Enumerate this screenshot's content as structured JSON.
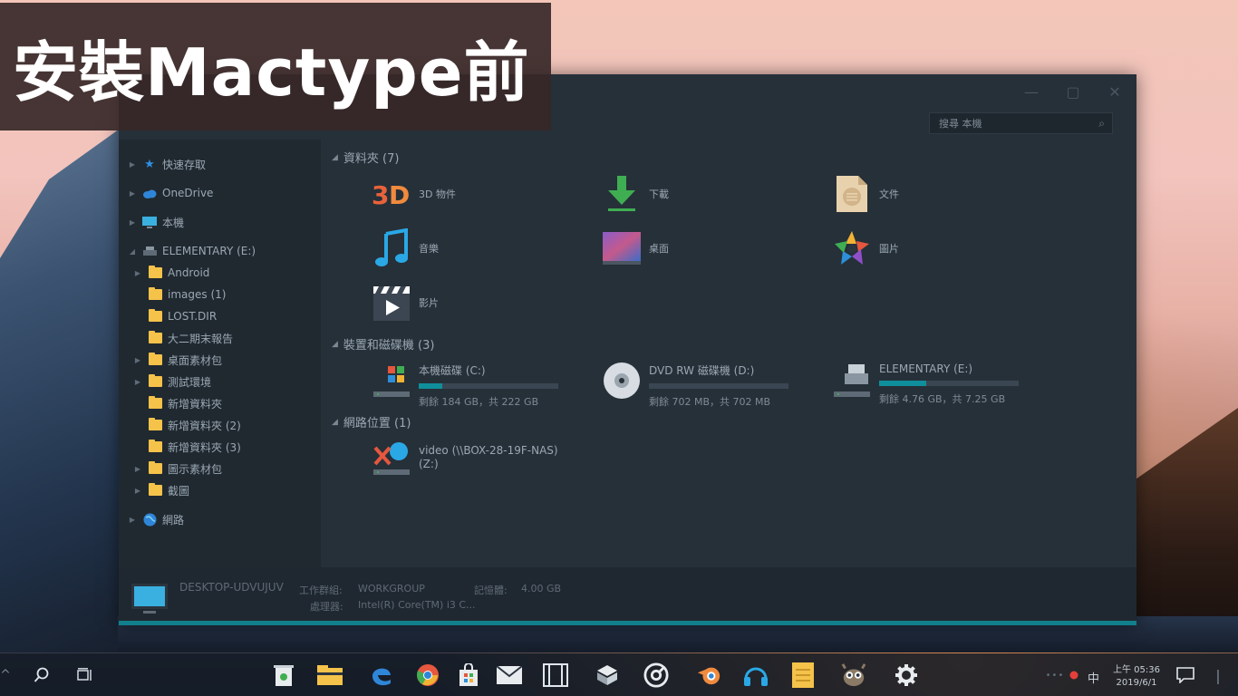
{
  "banner": {
    "title": "安裝Mactype前"
  },
  "window": {
    "search_placeholder": "搜尋 本機"
  },
  "nav": {
    "items": [
      {
        "label": "快速存取"
      },
      {
        "label": "OneDrive"
      },
      {
        "label": "本機"
      },
      {
        "label": "ELEMENTARY (E:)"
      },
      {
        "label": "Android"
      },
      {
        "label": "images (1)"
      },
      {
        "label": "LOST.DIR"
      },
      {
        "label": "大二期末報告"
      },
      {
        "label": "桌面素材包"
      },
      {
        "label": "測試環境"
      },
      {
        "label": "新增資料夾"
      },
      {
        "label": "新增資料夾 (2)"
      },
      {
        "label": "新增資料夾 (3)"
      },
      {
        "label": "圖示素材包"
      },
      {
        "label": "截圖"
      },
      {
        "label": "網路"
      }
    ]
  },
  "content": {
    "folders_header": "資料夾 (7)",
    "folders": [
      {
        "label": "3D 物件",
        "icon": "3d-objects-icon"
      },
      {
        "label": "下載",
        "icon": "download-icon"
      },
      {
        "label": "文件",
        "icon": "documents-icon"
      },
      {
        "label": "音樂",
        "icon": "music-icon"
      },
      {
        "label": "桌面",
        "icon": "desktop-icon"
      },
      {
        "label": "圖片",
        "icon": "pictures-icon"
      },
      {
        "label": "影片",
        "icon": "videos-icon"
      }
    ],
    "devices_header": "裝置和磁碟機 (3)",
    "drives": [
      {
        "name": "本機磁碟 (C:)",
        "space": "剩餘 184 GB，共 222 GB",
        "used_fraction": 0.17
      },
      {
        "name": "DVD RW 磁碟機 (D:)",
        "space": "剩餘 702 MB，共 702 MB",
        "used_fraction": 0.0
      },
      {
        "name": "ELEMENTARY (E:)",
        "space": "剩餘 4.76 GB，共 7.25 GB",
        "used_fraction": 0.34
      }
    ],
    "network_header": "網路位置 (1)",
    "network": {
      "label": "video (\\\\BOX-28-19F-NAS) (Z:)"
    }
  },
  "details": {
    "computer_name": "DESKTOP-UDVUJUV",
    "workgroup_label": "工作群組:",
    "workgroup_value": "WORKGROUP",
    "memory_label": "記憶體:",
    "memory_value": "4.00 GB",
    "cpu_label": "處理器:",
    "cpu_value": "Intel(R) Core(TM) i3 C..."
  },
  "taskbar": {
    "ime": "中",
    "time": "上午 05:36",
    "date": "2019/6/1"
  },
  "colors": {
    "accent": "#117f8c",
    "window_bg": "#263039",
    "nav_bg": "#202930",
    "folder": "#f5c24a"
  }
}
